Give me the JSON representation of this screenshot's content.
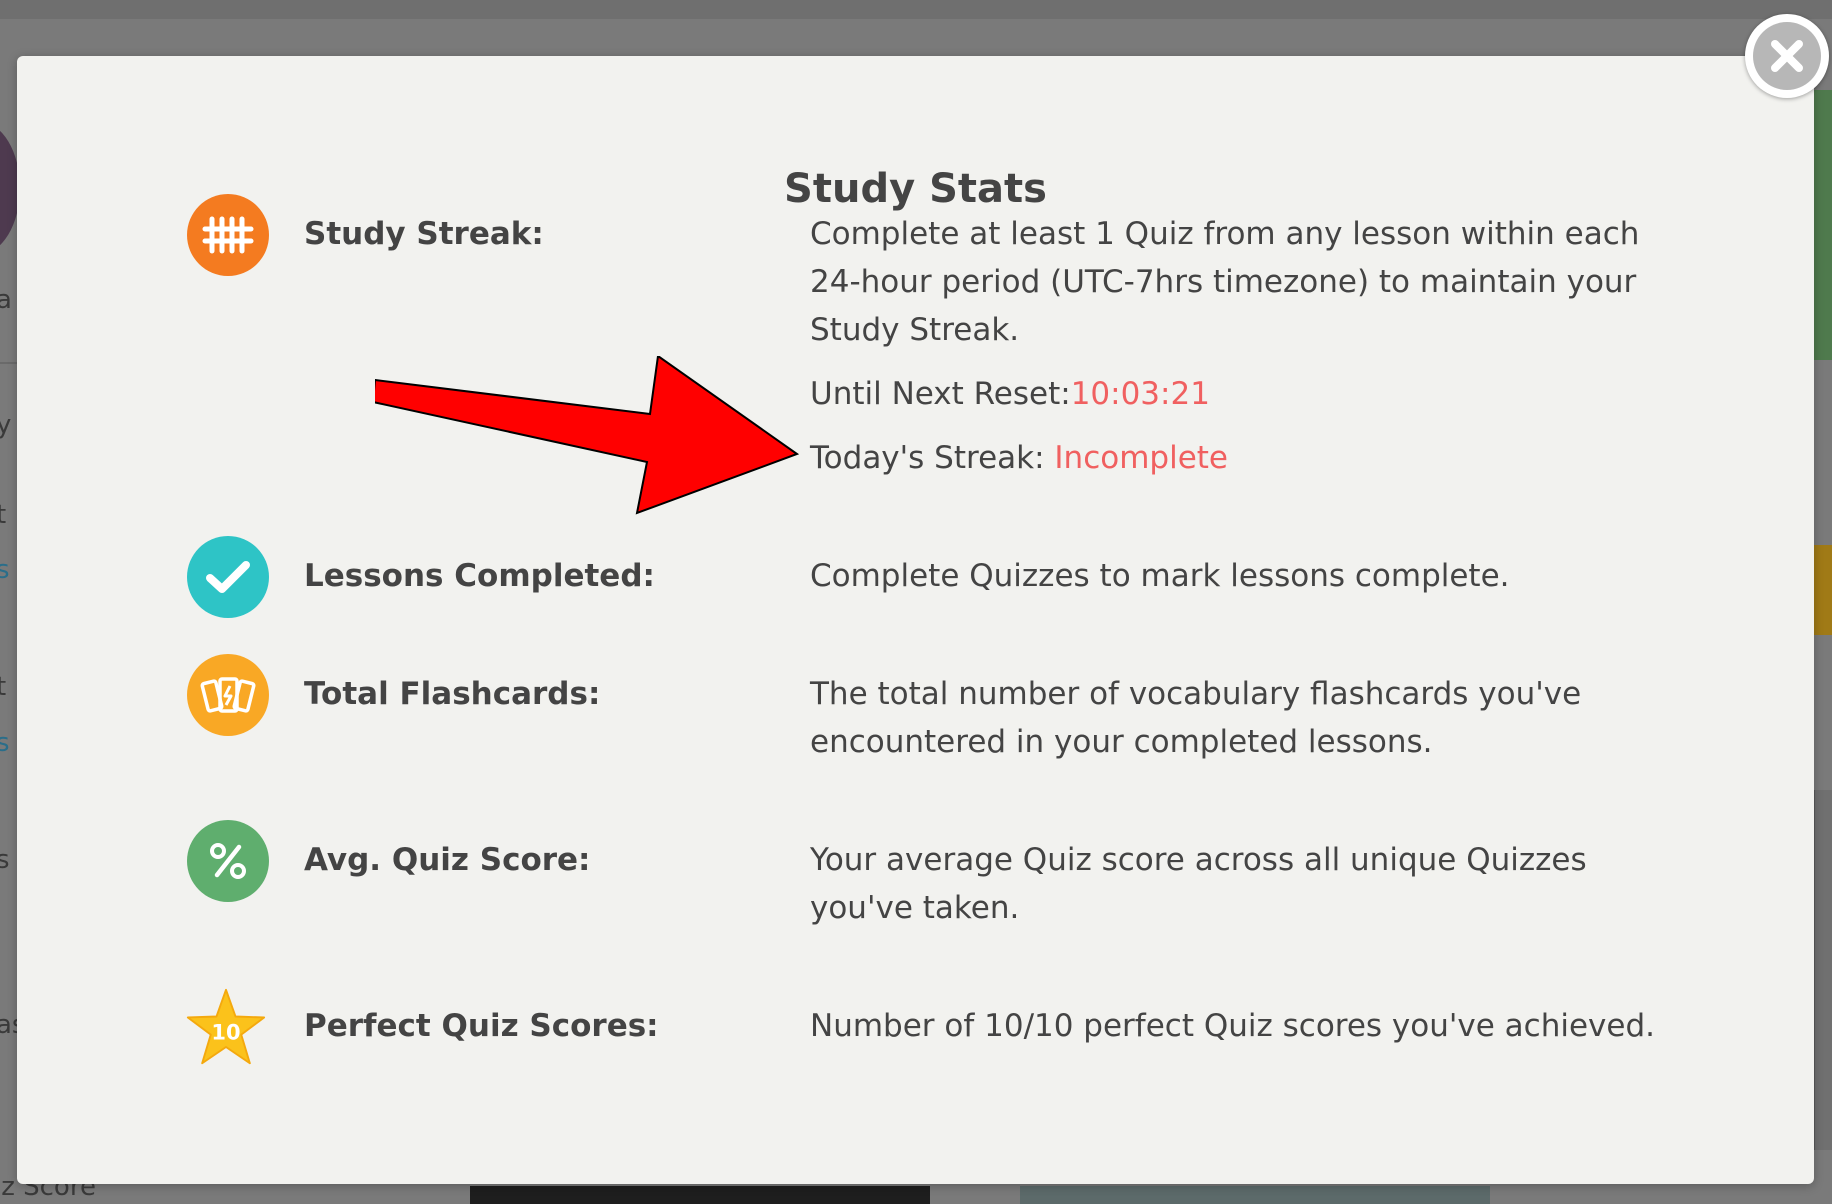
{
  "background": {
    "fragments": [
      "a",
      "y",
      "t",
      "s",
      "t",
      "s",
      "s",
      "as"
    ],
    "bottom_fragment": "iz Score"
  },
  "modal": {
    "title": "Study Stats",
    "close_icon": "close-icon",
    "stats": [
      {
        "icon": "tally-marks-icon",
        "icon_color": "#F47B20",
        "label": "Study Streak:",
        "description": "Complete at least 1 Quiz from any lesson within each 24-hour period (UTC-7hrs timezone) to maintain your Study Streak.",
        "reset_label": "Until Next Reset:",
        "reset_value": "10:03:21",
        "today_label": "Today's Streak: ",
        "today_value": "Incomplete"
      },
      {
        "icon": "checkmark-icon",
        "icon_color": "#2EC4C6",
        "label": "Lessons Completed:",
        "description": "Complete Quizzes to mark lessons complete."
      },
      {
        "icon": "flashcards-icon",
        "icon_color": "#F9A825",
        "label": "Total Flashcards:",
        "description": "The total number of vocabulary flashcards you've encountered in your completed lessons."
      },
      {
        "icon": "percent-icon",
        "icon_color": "#5FAE6E",
        "label": "Avg. Quiz Score:",
        "description": "Your average Quiz score across all unique Quizzes you've taken."
      },
      {
        "icon": "star-ten-icon",
        "icon_color": "#FBC21B",
        "icon_text": "10",
        "label": "Perfect Quiz Scores:",
        "description": "Number of 10/10 perfect Quiz scores you've achieved."
      }
    ]
  },
  "annotation": {
    "arrow_icon": "red-arrow-icon",
    "arrow_color": "#FF0000"
  },
  "colors": {
    "accent_red": "#F06060",
    "modal_bg": "#F2F2EF",
    "text": "#444444"
  }
}
